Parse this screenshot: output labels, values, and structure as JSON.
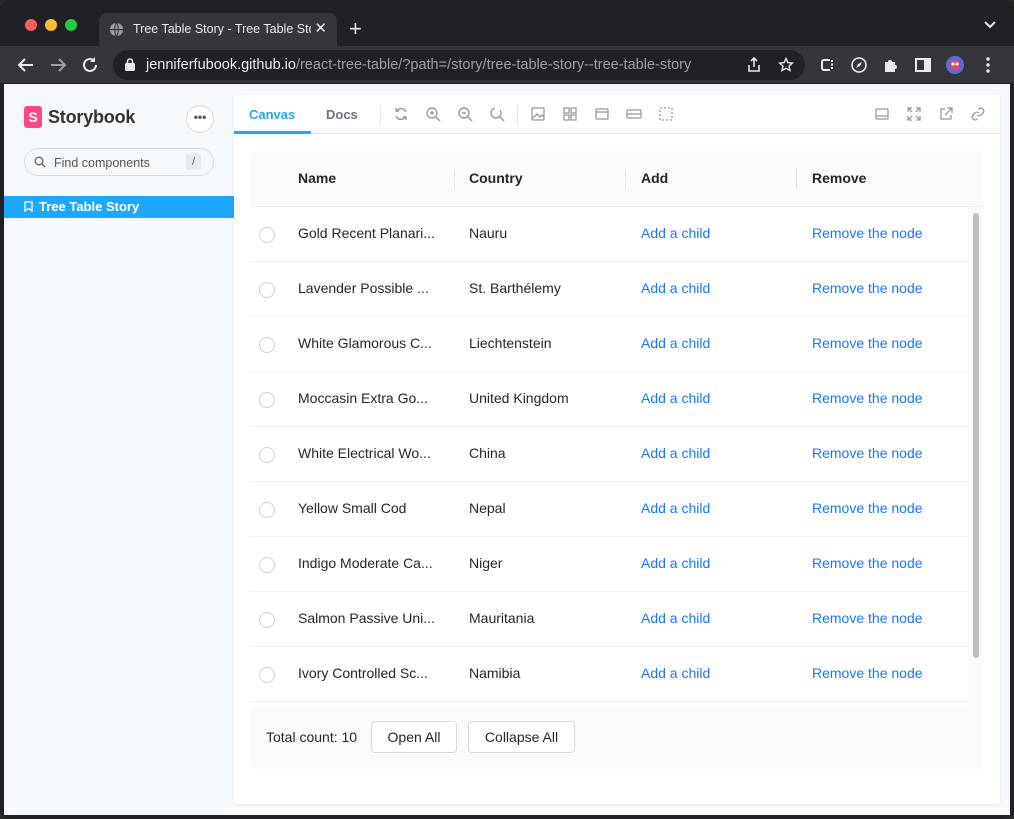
{
  "browser": {
    "tab_title": "Tree Table Story - Tree Table Story",
    "url_host": "jenniferfubook.github.io",
    "url_path": "/react-tree-table/?path=/story/tree-table-story--tree-table-story"
  },
  "sidebar": {
    "logo_letter": "S",
    "title": "Storybook",
    "menu_label": "•••",
    "search_placeholder": "Find components",
    "search_shortcut": "/",
    "items": [
      {
        "label": "Tree Table Story",
        "active": true
      }
    ]
  },
  "panel": {
    "tabs": [
      {
        "label": "Canvas",
        "active": true
      },
      {
        "label": "Docs",
        "active": false
      }
    ]
  },
  "table": {
    "columns": [
      "Name",
      "Country",
      "Add",
      "Remove"
    ],
    "rows": [
      {
        "name": "Gold Recent Planari...",
        "country": "Nauru",
        "add": "Add a child",
        "remove": "Remove the node"
      },
      {
        "name": "Lavender Possible ...",
        "country": "St. Barthélemy",
        "add": "Add a child",
        "remove": "Remove the node"
      },
      {
        "name": "White Glamorous C...",
        "country": "Liechtenstein",
        "add": "Add a child",
        "remove": "Remove the node"
      },
      {
        "name": "Moccasin Extra Go...",
        "country": "United Kingdom",
        "add": "Add a child",
        "remove": "Remove the node"
      },
      {
        "name": "White Electrical Wo...",
        "country": "China",
        "add": "Add a child",
        "remove": "Remove the node"
      },
      {
        "name": "Yellow Small Cod",
        "country": "Nepal",
        "add": "Add a child",
        "remove": "Remove the node"
      },
      {
        "name": "Indigo Moderate Ca...",
        "country": "Niger",
        "add": "Add a child",
        "remove": "Remove the node"
      },
      {
        "name": "Salmon Passive Uni...",
        "country": "Mauritania",
        "add": "Add a child",
        "remove": "Remove the node"
      },
      {
        "name": "Ivory Controlled Sc...",
        "country": "Namibia",
        "add": "Add a child",
        "remove": "Remove the node"
      }
    ],
    "total_label": "Total count: 10",
    "open_all_label": "Open All",
    "collapse_all_label": "Collapse All"
  },
  "colors": {
    "accent": "#1ea7fd",
    "link": "#1677ff",
    "storybook_pink": "#ff4785"
  }
}
